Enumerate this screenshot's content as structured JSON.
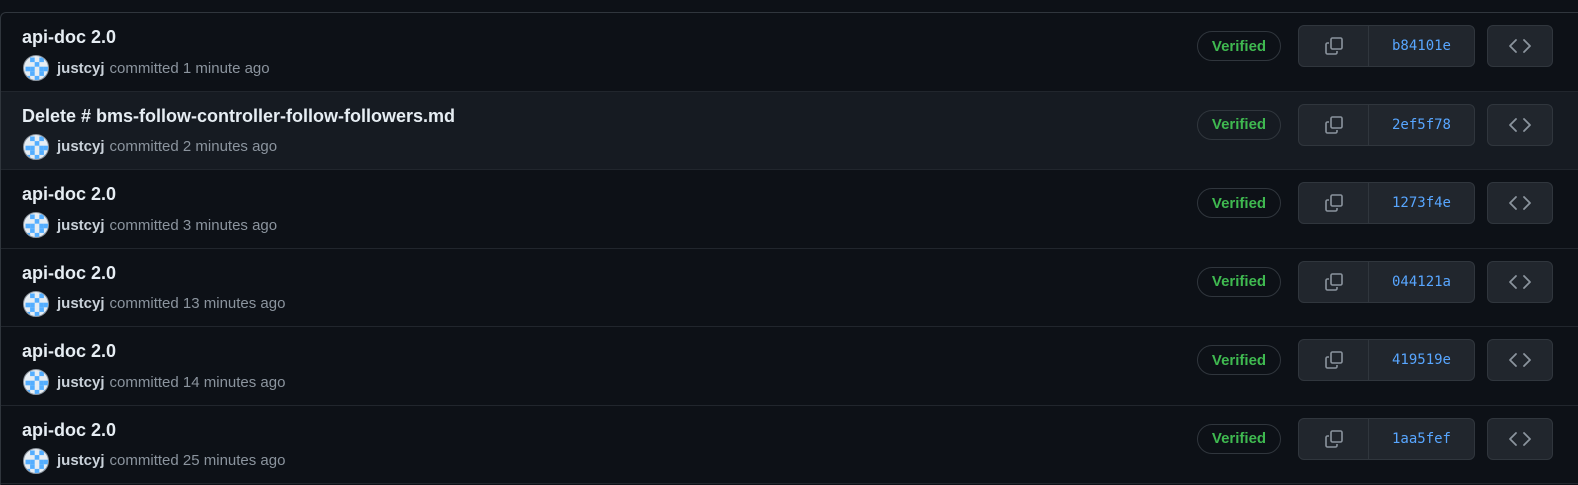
{
  "commits": [
    {
      "title": "api-doc 2.0",
      "author": "justcyj",
      "time": "committed 1 minute ago",
      "badge": "Verified",
      "sha": "b84101e"
    },
    {
      "title": "Delete # bms-follow-controller-follow-followers.md",
      "author": "justcyj",
      "time": "committed 2 minutes ago",
      "badge": "Verified",
      "sha": "2ef5f78"
    },
    {
      "title": "api-doc 2.0",
      "author": "justcyj",
      "time": "committed 3 minutes ago",
      "badge": "Verified",
      "sha": "1273f4e"
    },
    {
      "title": "api-doc 2.0",
      "author": "justcyj",
      "time": "committed 13 minutes ago",
      "badge": "Verified",
      "sha": "044121a"
    },
    {
      "title": "api-doc 2.0",
      "author": "justcyj",
      "time": "committed 14 minutes ago",
      "badge": "Verified",
      "sha": "419519e"
    },
    {
      "title": "api-doc 2.0",
      "author": "justcyj",
      "time": "committed 25 minutes ago",
      "badge": "Verified",
      "sha": "1aa5fef"
    }
  ],
  "icons": {
    "copy": "copy-icon",
    "browse": "code-icon",
    "avatar": "identicon"
  },
  "colors": {
    "background": "#0d1117",
    "verified": "#3fb950",
    "sha_link": "#58a6ff",
    "avatar_fill": "#54aeff"
  }
}
